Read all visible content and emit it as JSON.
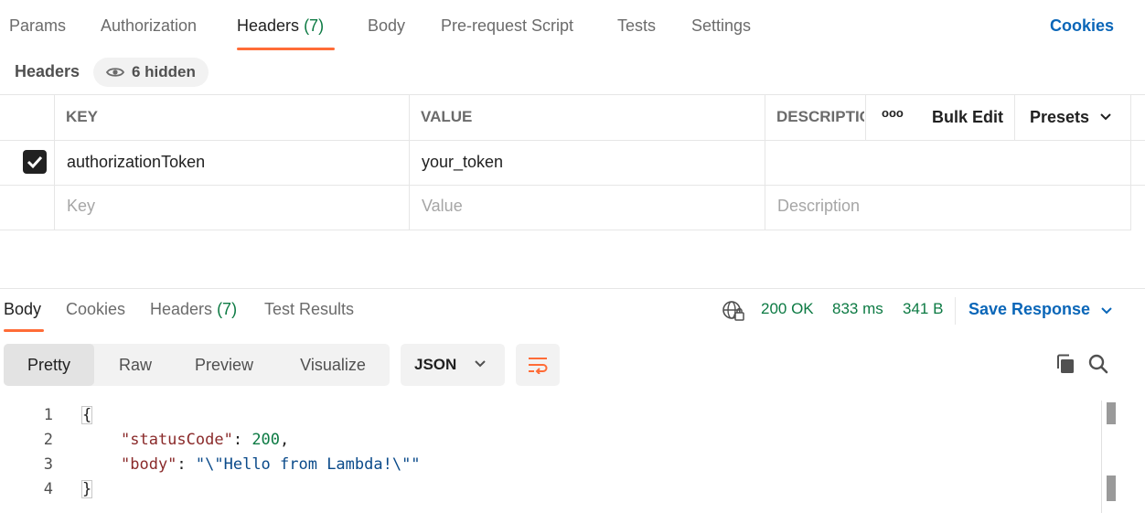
{
  "request_tabs": [
    {
      "label": "Params"
    },
    {
      "label": "Authorization"
    },
    {
      "label": "Headers",
      "count": "(7)"
    },
    {
      "label": "Body"
    },
    {
      "label": "Pre-request Script"
    },
    {
      "label": "Tests"
    },
    {
      "label": "Settings"
    }
  ],
  "cookies_link": "Cookies",
  "headers_section": {
    "title": "Headers",
    "hidden_label": "6 hidden",
    "columns": {
      "key": "KEY",
      "value": "VALUE",
      "description": "DESCRIPTION"
    },
    "more_icon": "ooo",
    "bulk_edit": "Bulk Edit",
    "presets": "Presets",
    "rows": [
      {
        "checked": true,
        "key": "authorizationToken",
        "value": "your_token",
        "description": ""
      }
    ],
    "placeholders": {
      "key": "Key",
      "value": "Value",
      "description": "Description"
    }
  },
  "response": {
    "tabs": [
      {
        "label": "Body"
      },
      {
        "label": "Cookies"
      },
      {
        "label": "Headers",
        "count": "(7)"
      },
      {
        "label": "Test Results"
      }
    ],
    "status": "200 OK",
    "time": "833 ms",
    "size": "341 B",
    "save_response": "Save Response",
    "view_modes": [
      "Pretty",
      "Raw",
      "Preview",
      "Visualize"
    ],
    "format": "JSON",
    "code_lines": [
      {
        "n": "1",
        "open": "{"
      },
      {
        "n": "2",
        "key": "\"statusCode\"",
        "sep": ": ",
        "val": "200",
        "end": ","
      },
      {
        "n": "3",
        "key": "\"body\"",
        "sep": ": ",
        "val": "\"\\\"Hello from Lambda!\\\"\"",
        "end": ""
      },
      {
        "n": "4",
        "close": "}"
      }
    ]
  },
  "colors": {
    "accent": "#ff6c37",
    "link": "#0a66b8",
    "success": "#0c7a43"
  }
}
